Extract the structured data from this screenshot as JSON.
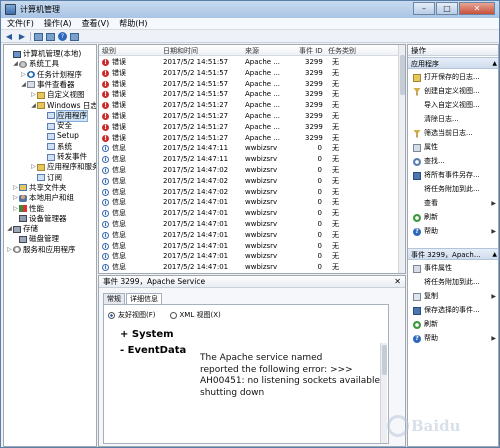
{
  "window": {
    "title": "计算机管理",
    "min": "–",
    "max": "□",
    "close": "✕"
  },
  "menu": [
    "文件(F)",
    "操作(A)",
    "查看(V)",
    "帮助(H)"
  ],
  "tree": [
    {
      "label": "计算机管理(本地)",
      "twisty": "",
      "icon": "i-pc"
    },
    {
      "label": "系统工具",
      "twisty": "◢",
      "icon": "i-gear"
    },
    {
      "label": "任务计划程序",
      "twisty": "▷",
      "icon": "i-clock"
    },
    {
      "label": "事件查看器",
      "twisty": "◢",
      "icon": "i-log"
    },
    {
      "label": "自定义视图",
      "twisty": "▷",
      "icon": "i-folder"
    },
    {
      "label": "Windows 日志",
      "twisty": "◢",
      "icon": "i-folder"
    },
    {
      "label": "应用程序",
      "twisty": "",
      "icon": "i-sub",
      "selected": true
    },
    {
      "label": "安全",
      "twisty": "",
      "icon": "i-sub"
    },
    {
      "label": "Setup",
      "twisty": "",
      "icon": "i-sub"
    },
    {
      "label": "系统",
      "twisty": "",
      "icon": "i-sub"
    },
    {
      "label": "转发事件",
      "twisty": "",
      "icon": "i-sub"
    },
    {
      "label": "应用程序和服务",
      "twisty": "▷",
      "icon": "i-folder"
    },
    {
      "label": "订阅",
      "twisty": "",
      "icon": "i-sub"
    },
    {
      "label": "共享文件夹",
      "twisty": "▷",
      "icon": "i-share"
    },
    {
      "label": "本地用户和组",
      "twisty": "▷",
      "icon": "i-user"
    },
    {
      "label": "性能",
      "twisty": "▷",
      "icon": "i-perf"
    },
    {
      "label": "设备管理器",
      "twisty": "",
      "icon": "i-dev"
    },
    {
      "label": "存储",
      "twisty": "◢",
      "icon": "i-disk"
    },
    {
      "label": "磁盘管理",
      "twisty": "",
      "icon": "i-disk"
    },
    {
      "label": "服务和应用程序",
      "twisty": "▷",
      "icon": "i-svc"
    }
  ],
  "columns": [
    "级别",
    "日期和时间",
    "来源",
    "事件 ID",
    "任务类别"
  ],
  "events": [
    {
      "level": "错误",
      "type": "err",
      "date": "2017/5/2 14:51:57",
      "source": "Apache ...",
      "id": "3299",
      "cat": "无"
    },
    {
      "level": "错误",
      "type": "err",
      "date": "2017/5/2 14:51:57",
      "source": "Apache ...",
      "id": "3299",
      "cat": "无"
    },
    {
      "level": "错误",
      "type": "err",
      "date": "2017/5/2 14:51:57",
      "source": "Apache ...",
      "id": "3299",
      "cat": "无"
    },
    {
      "level": "错误",
      "type": "err",
      "date": "2017/5/2 14:51:57",
      "source": "Apache ...",
      "id": "3299",
      "cat": "无"
    },
    {
      "level": "错误",
      "type": "err",
      "date": "2017/5/2 14:51:27",
      "source": "Apache ...",
      "id": "3299",
      "cat": "无"
    },
    {
      "level": "错误",
      "type": "err",
      "date": "2017/5/2 14:51:27",
      "source": "Apache ...",
      "id": "3299",
      "cat": "无"
    },
    {
      "level": "错误",
      "type": "err",
      "date": "2017/5/2 14:51:27",
      "source": "Apache ...",
      "id": "3299",
      "cat": "无"
    },
    {
      "level": "错误",
      "type": "err",
      "date": "2017/5/2 14:51:27",
      "source": "Apache ...",
      "id": "3299",
      "cat": "无"
    },
    {
      "level": "信息",
      "type": "info",
      "date": "2017/5/2 14:47:11",
      "source": "wwbizsrv",
      "id": "0",
      "cat": "无"
    },
    {
      "level": "信息",
      "type": "info",
      "date": "2017/5/2 14:47:11",
      "source": "wwbizsrv",
      "id": "0",
      "cat": "无"
    },
    {
      "level": "信息",
      "type": "info",
      "date": "2017/5/2 14:47:02",
      "source": "wwbizsrv",
      "id": "0",
      "cat": "无"
    },
    {
      "level": "信息",
      "type": "info",
      "date": "2017/5/2 14:47:02",
      "source": "wwbizsrv",
      "id": "0",
      "cat": "无"
    },
    {
      "level": "信息",
      "type": "info",
      "date": "2017/5/2 14:47:02",
      "source": "wwbizsrv",
      "id": "0",
      "cat": "无"
    },
    {
      "level": "信息",
      "type": "info",
      "date": "2017/5/2 14:47:01",
      "source": "wwbizsrv",
      "id": "0",
      "cat": "无"
    },
    {
      "level": "信息",
      "type": "info",
      "date": "2017/5/2 14:47:01",
      "source": "wwbizsrv",
      "id": "0",
      "cat": "无"
    },
    {
      "level": "信息",
      "type": "info",
      "date": "2017/5/2 14:47:01",
      "source": "wwbizsrv",
      "id": "0",
      "cat": "无"
    },
    {
      "level": "信息",
      "type": "info",
      "date": "2017/5/2 14:47:01",
      "source": "wwbizsrv",
      "id": "0",
      "cat": "无"
    },
    {
      "level": "信息",
      "type": "info",
      "date": "2017/5/2 14:47:01",
      "source": "wwbizsrv",
      "id": "0",
      "cat": "无"
    },
    {
      "level": "信息",
      "type": "info",
      "date": "2017/5/2 14:47:01",
      "source": "wwbizsrv",
      "id": "0",
      "cat": "无"
    },
    {
      "level": "信息",
      "type": "info",
      "date": "2017/5/2 14:47:01",
      "source": "wwbizsrv",
      "id": "0",
      "cat": "无"
    }
  ],
  "detail": {
    "header": "事件 3299，Apache Service",
    "close": "✕",
    "tabs": [
      "常规",
      "详细信息"
    ],
    "friendly": "友好视图(F)",
    "xml": "XML 视图(X)",
    "system": "+ System",
    "eventdata": "- EventData",
    "message_lines": [
      "The Apache service named",
      "reported the following error: >>>",
      "AH00451: no listening sockets available,",
      "shutting down"
    ]
  },
  "actions": {
    "title": "操作",
    "section1": "应用程序",
    "items1": [
      {
        "label": "打开保存的日志...",
        "icon": "ai-open"
      },
      {
        "label": "创建自定义视图...",
        "icon": "ai-filter"
      },
      {
        "label": "导入自定义视图...",
        "icon": "ai-blank"
      },
      {
        "label": "清除日志...",
        "icon": "ai-blank"
      },
      {
        "label": "筛选当前日志...",
        "icon": "ai-filter"
      },
      {
        "label": "属性",
        "icon": "ai-prop"
      },
      {
        "label": "查找...",
        "icon": "ai-find"
      },
      {
        "label": "将所有事件另存...",
        "icon": "ai-save"
      },
      {
        "label": "将任务附加到此...",
        "icon": "ai-blank"
      },
      {
        "label": "查看",
        "icon": "ai-blank",
        "arrow": "▶"
      },
      {
        "label": "刷新",
        "icon": "ai-refresh"
      },
      {
        "label": "帮助",
        "icon": "ai-help",
        "arrow": "▶"
      }
    ],
    "section2": "事件 3299，Apach...",
    "items2": [
      {
        "label": "事件属性",
        "icon": "ai-prop"
      },
      {
        "label": "将任务附加到此...",
        "icon": "ai-blank"
      },
      {
        "label": "复制",
        "icon": "ai-copy",
        "arrow": "▶"
      },
      {
        "label": "保存选择的事件...",
        "icon": "ai-save"
      },
      {
        "label": "刷新",
        "icon": "ai-refresh"
      },
      {
        "label": "帮助",
        "icon": "ai-help",
        "arrow": "▶"
      }
    ]
  },
  "watermark": "Baidu"
}
